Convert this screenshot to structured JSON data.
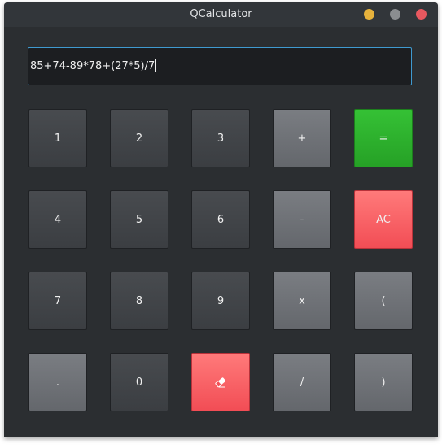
{
  "window": {
    "title": "QCalculator",
    "controls": [
      "minimize",
      "maximize",
      "close"
    ]
  },
  "display": {
    "value": "85+74-89*78+(27*5)/7"
  },
  "keys": {
    "k1": "1",
    "k2": "2",
    "k3": "3",
    "plus": "+",
    "equals": "=",
    "k4": "4",
    "k5": "5",
    "k6": "6",
    "minus": "-",
    "ac": "AC",
    "k7": "7",
    "k8": "8",
    "k9": "9",
    "multiply": "x",
    "lparen": "(",
    "dot": ".",
    "k0": "0",
    "erase_icon": "eraser-icon",
    "divide": "/",
    "rparen": ")"
  },
  "colors": {
    "equals": "#2bb12b",
    "ac": "#ff5f64",
    "erase": "#ff5f64",
    "accent": "#3f9ad0"
  }
}
